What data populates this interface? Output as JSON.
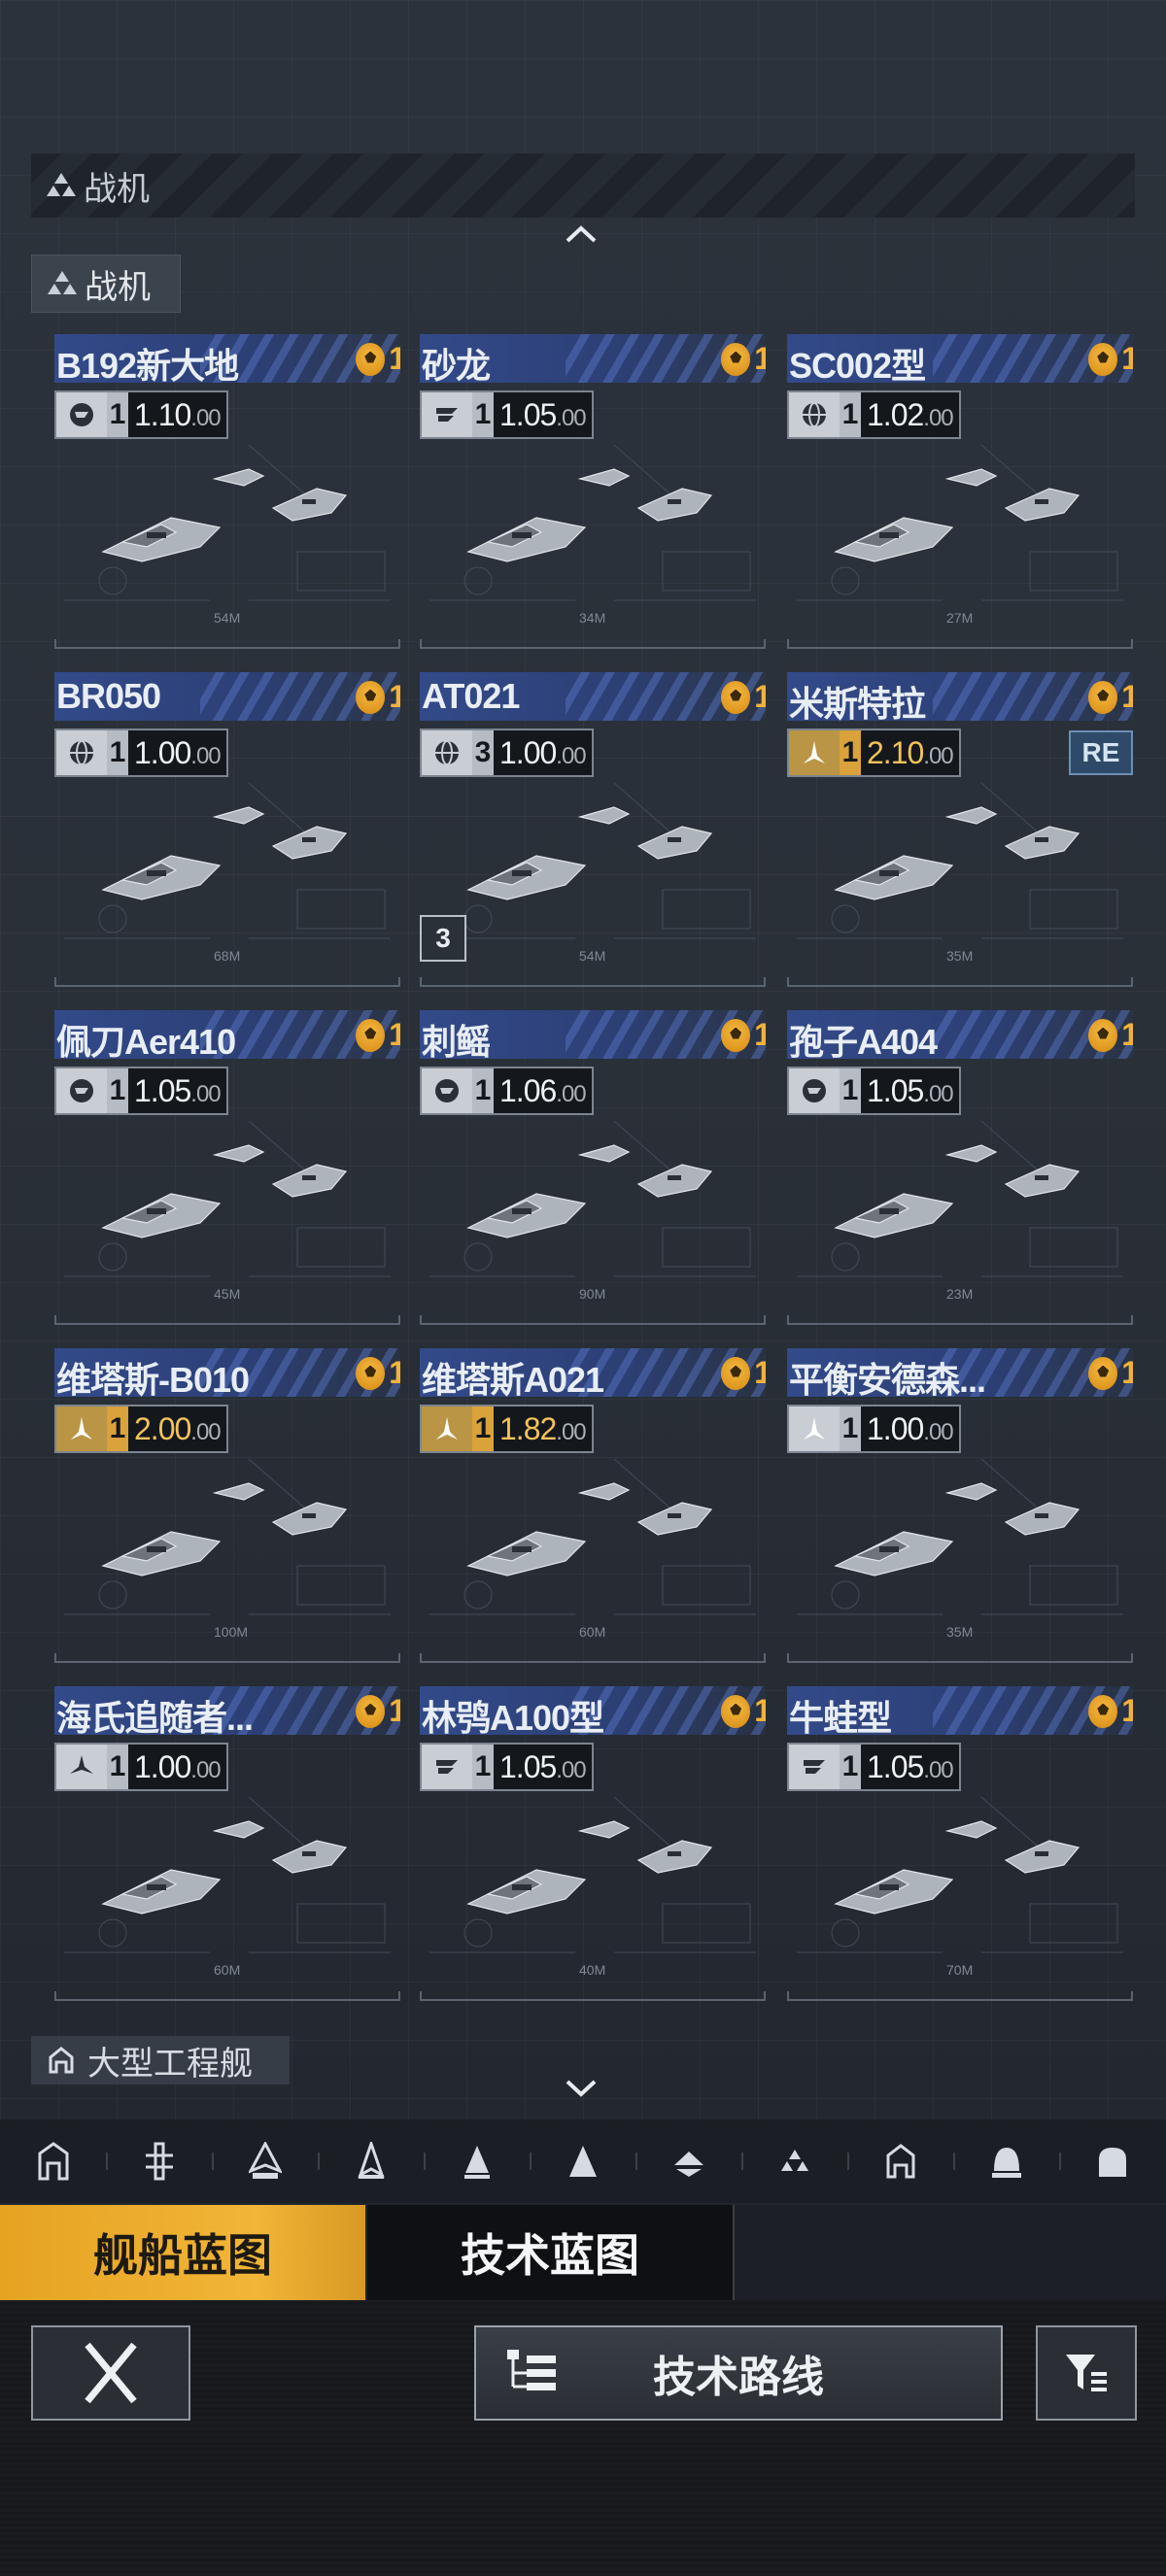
{
  "section": {
    "title": "战机"
  },
  "subsection": {
    "title": "战机"
  },
  "cards": [
    {
      "name": "B192新大地",
      "rank": "1",
      "level": "1",
      "value": "1.10",
      "frac": ".00",
      "icon": "fighter-type-icon",
      "gold": false
    },
    {
      "name": "砂龙",
      "rank": "1",
      "level": "1",
      "value": "1.05",
      "frac": ".00",
      "icon": "rank-insignia-icon",
      "gold": false
    },
    {
      "name": "SC002型",
      "rank": "1",
      "level": "1",
      "value": "1.02",
      "frac": ".00",
      "icon": "globe-icon",
      "gold": false
    },
    {
      "name": "BR050",
      "rank": "1",
      "level": "1",
      "value": "1.00",
      "frac": ".00",
      "icon": "globe-icon",
      "gold": false
    },
    {
      "name": "AT021",
      "rank": "1",
      "level": "3",
      "value": "1.00",
      "frac": ".00",
      "icon": "globe-icon",
      "gold": false,
      "count": "3"
    },
    {
      "name": "米斯特拉",
      "rank": "1",
      "level": "1",
      "value": "2.10",
      "frac": ".00",
      "icon": "faction-icon",
      "gold": true,
      "badge": "RE"
    },
    {
      "name": "佩刀Aer410",
      "rank": "1",
      "level": "1",
      "value": "1.05",
      "frac": ".00",
      "icon": "fighter-type-icon",
      "gold": false
    },
    {
      "name": "刺鳐",
      "rank": "1",
      "level": "1",
      "value": "1.06",
      "frac": ".00",
      "icon": "fighter-type-icon",
      "gold": false
    },
    {
      "name": "孢子A404",
      "rank": "1",
      "level": "1",
      "value": "1.05",
      "frac": ".00",
      "icon": "fighter-type-icon",
      "gold": false
    },
    {
      "name": "维塔斯-B010",
      "rank": "1",
      "level": "1",
      "value": "2.00",
      "frac": ".00",
      "icon": "faction-icon",
      "gold": true
    },
    {
      "name": "维塔斯A021",
      "rank": "1",
      "level": "1",
      "value": "1.82",
      "frac": ".00",
      "icon": "faction-icon",
      "gold": true
    },
    {
      "name": "平衡安德森...",
      "rank": "1",
      "level": "1",
      "value": "1.00",
      "frac": ".00",
      "icon": "faction-icon",
      "gold": false
    },
    {
      "name": "海氏追随者...",
      "rank": "1",
      "level": "1",
      "value": "1.00",
      "frac": ".00",
      "icon": "tri-icon",
      "gold": false
    },
    {
      "name": "林鸮A100型",
      "rank": "1",
      "level": "1",
      "value": "1.05",
      "frac": ".00",
      "icon": "rank-insignia-icon",
      "gold": false
    },
    {
      "name": "牛蛙型",
      "rank": "1",
      "level": "1",
      "value": "1.05",
      "frac": ".00",
      "icon": "rank-insignia-icon",
      "gold": false
    }
  ],
  "lengths": [
    "54M",
    "34M",
    "27M",
    "68M",
    "54M",
    "35M",
    "45M",
    "90M",
    "23M",
    "100M",
    "60M",
    "35M",
    "60M",
    "40M",
    "70M"
  ],
  "subsection2": {
    "title": "大型工程舰"
  },
  "category_icons": [
    "station-icon",
    "carrier-icon",
    "battleship-icon",
    "cruiser-icon",
    "destroyer-icon",
    "frigate-icon",
    "corvette-icon",
    "fighter-icon",
    "engineering-icon",
    "dome-icon",
    "shield-icon"
  ],
  "tabs": {
    "active": "舰船蓝图",
    "inactive": "技术蓝图"
  },
  "bottom": {
    "route_label": "技术路线"
  },
  "colors": {
    "accent": "#f1b537",
    "card_head": "#334a8a",
    "rank_gold": "#f1b23b"
  }
}
